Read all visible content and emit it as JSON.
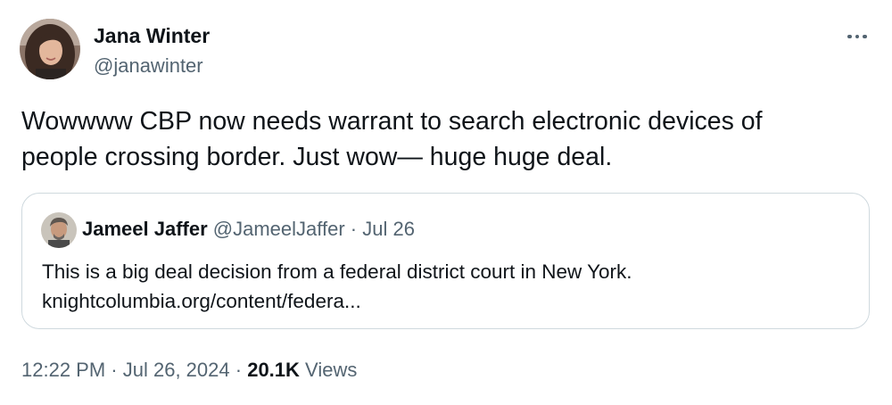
{
  "tweet": {
    "author_name": "Jana Winter",
    "author_handle": "@janawinter",
    "text_lines": [
      "Wowwww CBP now needs warrant to search electronic devices of",
      "people crossing border. Just wow— huge huge deal."
    ],
    "time": "12:22 PM",
    "date": "Jul 26, 2024",
    "separator": "·",
    "views_count": "20.1K",
    "views_label": "Views"
  },
  "quote": {
    "author_name": "Jameel Jaffer",
    "author_handle": "@JameelJaffer",
    "separator": "·",
    "date": "Jul 26",
    "text_lines": [
      "This is a big deal decision from a federal district court in New York.",
      "knightcolumbia.org/content/federa..."
    ]
  },
  "icons": {
    "more": "more-horizontal-icon",
    "avatar": "profile-photo",
    "quote_avatar": "profile-photo"
  },
  "colors": {
    "text_primary": "#0f1419",
    "text_secondary": "#536471",
    "border": "#cfd9de"
  }
}
